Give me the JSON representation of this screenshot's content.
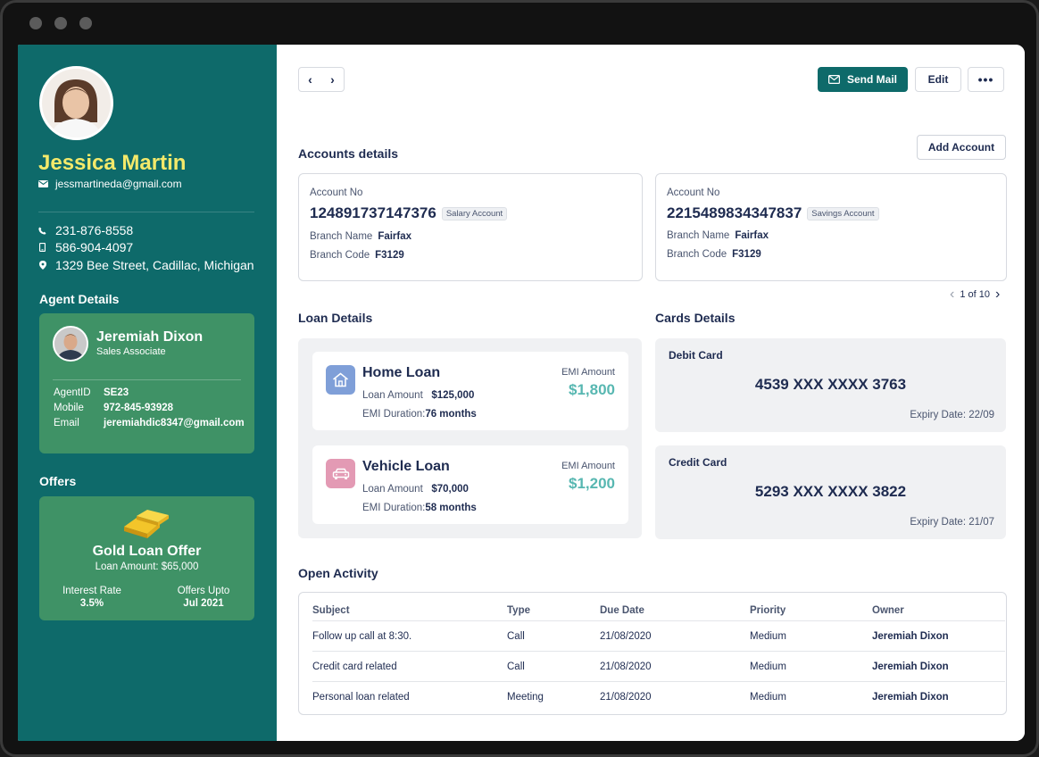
{
  "profile": {
    "name": "Jessica Martin",
    "email": "jessmartineda@gmail.com",
    "phone": "231-876-8558",
    "mobile": "586-904-4097",
    "address": "1329  Bee Street, Cadillac, Michigan"
  },
  "agent": {
    "heading": "Agent Details",
    "name": "Jeremiah Dixon",
    "role": "Sales Associate",
    "fields": [
      {
        "label": "AgentID",
        "value": "SE23"
      },
      {
        "label": "Mobile",
        "value": "972-845-93928"
      },
      {
        "label": "Email",
        "value": "jeremiahdic8347@gmail.com"
      }
    ]
  },
  "offers": {
    "heading": "Offers",
    "title": "Gold Loan Offer",
    "amount": "Loan Amount: $65,000",
    "rate_label": "Interest Rate",
    "rate_value": "3.5%",
    "upto_label": "Offers Upto",
    "upto_value": "Jul 2021"
  },
  "toolbar": {
    "send_mail": "Send Mail",
    "edit": "Edit",
    "more": "•••"
  },
  "accounts": {
    "heading": "Accounts details",
    "add_button": "Add Account",
    "pager": "1 of 10",
    "items": [
      {
        "label": "Account No",
        "number": "124891737147376",
        "type": "Salary Account",
        "branch_name_label": "Branch Name",
        "branch_name": "Fairfax",
        "branch_code_label": "Branch Code",
        "branch_code": "F3129"
      },
      {
        "label": "Account No",
        "number": "2215489834347837",
        "type": "Savings Account",
        "branch_name_label": "Branch Name",
        "branch_name": "Fairfax",
        "branch_code_label": "Branch Code",
        "branch_code": "F3129"
      }
    ]
  },
  "loans": {
    "heading": "Loan Details",
    "items": [
      {
        "name": "Home Loan",
        "amount_label": "Loan Amount",
        "amount": "$125,000",
        "duration_label": "EMI Duration:",
        "duration": "76 months",
        "emi_label": "EMI Amount",
        "emi": "$1,800",
        "icon": "home-icon",
        "color": "#7f9fd8"
      },
      {
        "name": "Vehicle Loan",
        "amount_label": "Loan Amount",
        "amount": "$70,000",
        "duration_label": "EMI Duration:",
        "duration": "58 months",
        "emi_label": "EMI Amount",
        "emi": "$1,200",
        "icon": "car-icon",
        "color": "#e39ab4"
      }
    ]
  },
  "cards": {
    "heading": "Cards Details",
    "items": [
      {
        "type": "Debit Card",
        "number": "4539 XXX XXXX 3763",
        "expiry": "Expiry Date: 22/09"
      },
      {
        "type": "Credit Card",
        "number": "5293 XXX XXXX 3822",
        "expiry": "Expiry Date: 21/07"
      }
    ]
  },
  "activity": {
    "heading": "Open Activity",
    "columns": [
      "Subject",
      "Type",
      "Due Date",
      "Priority",
      "Owner"
    ],
    "rows": [
      [
        "Follow up call at 8:30.",
        "Call",
        "21/08/2020",
        "Medium",
        "Jeremiah Dixon"
      ],
      [
        "Credit card related",
        "Call",
        "21/08/2020",
        "Medium",
        "Jeremiah Dixon"
      ],
      [
        "Personal loan related",
        "Meeting",
        "21/08/2020",
        "Medium",
        "Jeremiah Dixon"
      ]
    ]
  },
  "colors": {
    "sidebar": "#0e6a6a",
    "card_green": "#3f9266",
    "name_yellow": "#f4e96a",
    "emi_teal": "#57b7b1"
  }
}
